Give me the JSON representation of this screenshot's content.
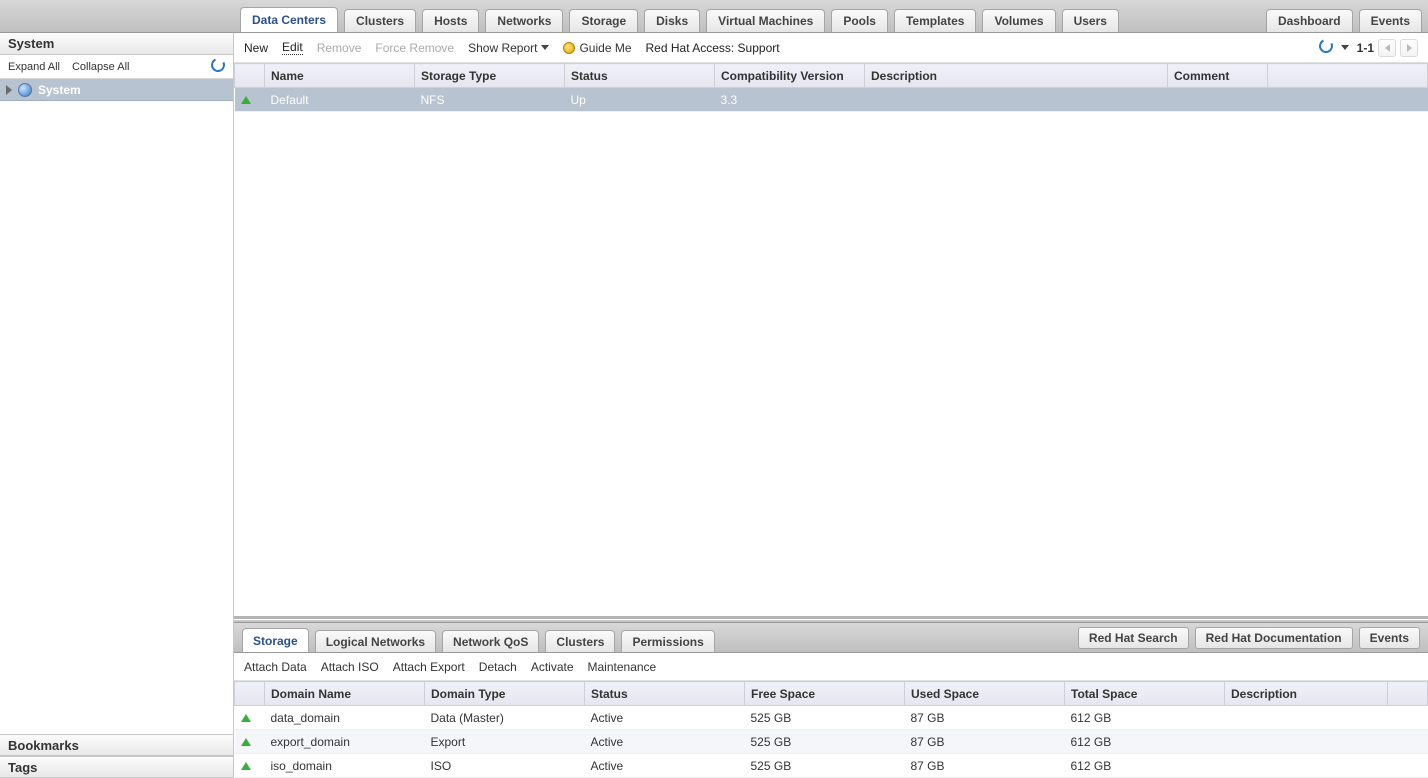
{
  "top_tabs": {
    "items": [
      {
        "label": "Data Centers",
        "active": true
      },
      {
        "label": "Clusters"
      },
      {
        "label": "Hosts"
      },
      {
        "label": "Networks"
      },
      {
        "label": "Storage"
      },
      {
        "label": "Disks"
      },
      {
        "label": "Virtual Machines"
      },
      {
        "label": "Pools"
      },
      {
        "label": "Templates"
      },
      {
        "label": "Volumes"
      },
      {
        "label": "Users"
      }
    ],
    "right": [
      {
        "label": "Dashboard"
      },
      {
        "label": "Events"
      }
    ]
  },
  "sidebar": {
    "title": "System",
    "expand": "Expand All",
    "collapse": "Collapse All",
    "root": "System",
    "sections": [
      {
        "label": "Bookmarks"
      },
      {
        "label": "Tags"
      }
    ]
  },
  "toolbar": {
    "new": "New",
    "edit": "Edit",
    "remove": "Remove",
    "force_remove": "Force Remove",
    "show_report": "Show Report",
    "guide": "Guide Me",
    "rh_access": "Red Hat Access: Support",
    "range": "1-1"
  },
  "main_table": {
    "cols": [
      "",
      "Name",
      "Storage Type",
      "Status",
      "Compatibility Version",
      "Description",
      "Comment",
      ""
    ],
    "rows": [
      {
        "name": "Default",
        "storage_type": "NFS",
        "status": "Up",
        "compat": "3.3",
        "desc": "",
        "comment": ""
      }
    ]
  },
  "sub_tabs": {
    "items": [
      {
        "label": "Storage",
        "active": true
      },
      {
        "label": "Logical Networks"
      },
      {
        "label": "Network QoS"
      },
      {
        "label": "Clusters"
      },
      {
        "label": "Permissions"
      }
    ],
    "right": [
      {
        "label": "Red Hat Search"
      },
      {
        "label": "Red Hat Documentation"
      },
      {
        "label": "Events"
      }
    ]
  },
  "sub_toolbar": {
    "attach_data": "Attach Data",
    "attach_iso": "Attach ISO",
    "attach_export": "Attach Export",
    "detach": "Detach",
    "activate": "Activate",
    "maintenance": "Maintenance"
  },
  "sub_table": {
    "cols": [
      "",
      "Domain Name",
      "Domain Type",
      "Status",
      "Free Space",
      "Used Space",
      "Total Space",
      "Description",
      ""
    ],
    "rows": [
      {
        "name": "data_domain",
        "type": "Data (Master)",
        "status": "Active",
        "free": "525 GB",
        "used": "87 GB",
        "total": "612 GB",
        "desc": ""
      },
      {
        "name": "export_domain",
        "type": "Export",
        "status": "Active",
        "free": "525 GB",
        "used": "87 GB",
        "total": "612 GB",
        "desc": ""
      },
      {
        "name": "iso_domain",
        "type": "ISO",
        "status": "Active",
        "free": "525 GB",
        "used": "87 GB",
        "total": "612 GB",
        "desc": ""
      }
    ]
  }
}
